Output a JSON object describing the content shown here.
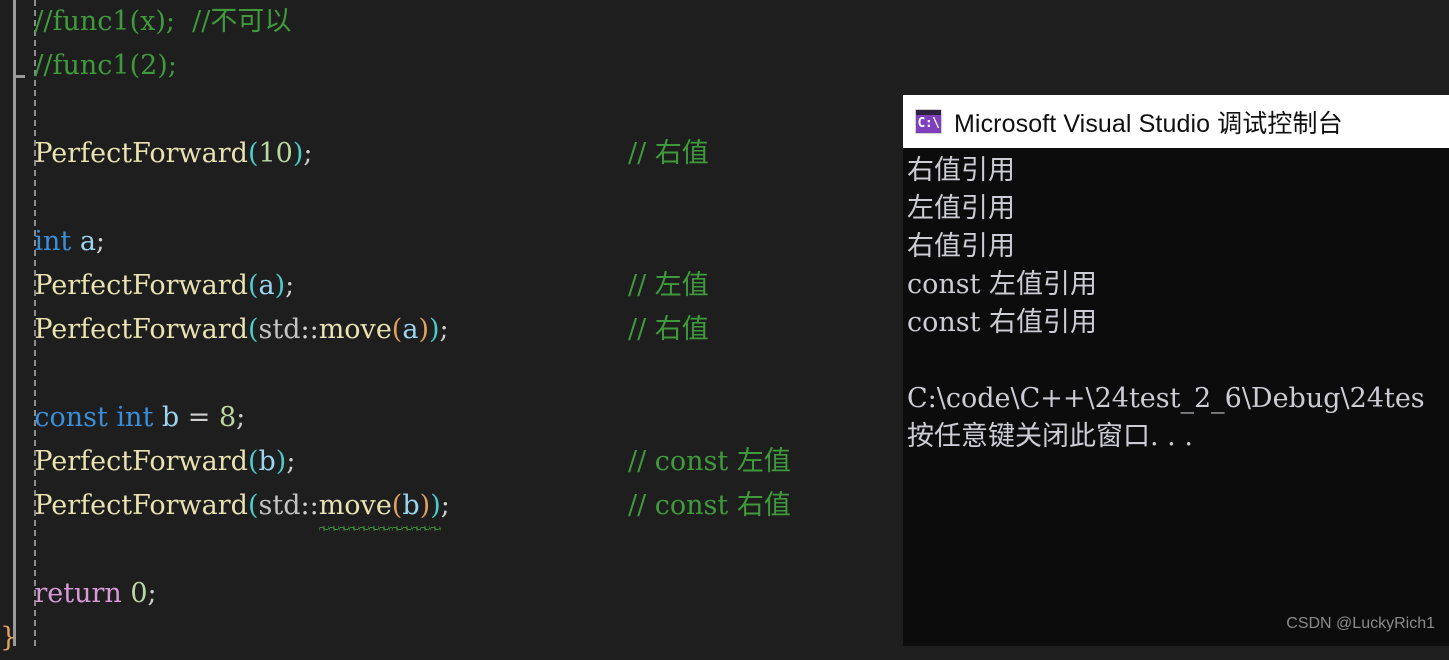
{
  "editor": {
    "background": "#1e1e1e",
    "gutter_guide_color": "#9a9a9a",
    "indent_guide_color": "#8c8c8c",
    "closing_brace": "}",
    "lines": [
      {
        "id": "line-func1-x",
        "segments": [
          {
            "cls": "t-cmt",
            "text": "    //func1(x);  //不可以"
          }
        ],
        "comment": ""
      },
      {
        "id": "line-func1-2",
        "segments": [
          {
            "cls": "t-cmt",
            "text": "    //func1(2);"
          }
        ],
        "comment": ""
      },
      {
        "id": "line-blank-1",
        "segments": [],
        "comment": ""
      },
      {
        "id": "line-pf-10",
        "segments": [
          {
            "cls": "",
            "text": "    "
          },
          {
            "cls": "t-fn",
            "text": "PerfectForward"
          },
          {
            "cls": "t-p1",
            "text": "("
          },
          {
            "cls": "t-num",
            "text": "10"
          },
          {
            "cls": "t-p1",
            "text": ")"
          },
          {
            "cls": "t-pun",
            "text": ";"
          }
        ],
        "comment": "// 右值"
      },
      {
        "id": "line-blank-2",
        "segments": [],
        "comment": ""
      },
      {
        "id": "line-int-a",
        "segments": [
          {
            "cls": "",
            "text": "    "
          },
          {
            "cls": "t-kw",
            "text": "int"
          },
          {
            "cls": "",
            "text": " "
          },
          {
            "cls": "t-var",
            "text": "a"
          },
          {
            "cls": "t-pun",
            "text": ";"
          }
        ],
        "comment": ""
      },
      {
        "id": "line-pf-a",
        "segments": [
          {
            "cls": "",
            "text": "    "
          },
          {
            "cls": "t-fn",
            "text": "PerfectForward"
          },
          {
            "cls": "t-p1",
            "text": "("
          },
          {
            "cls": "t-var",
            "text": "a"
          },
          {
            "cls": "t-p1",
            "text": ")"
          },
          {
            "cls": "t-pun",
            "text": ";"
          }
        ],
        "comment": "// 左值"
      },
      {
        "id": "line-pf-move-a",
        "segments": [
          {
            "cls": "",
            "text": "    "
          },
          {
            "cls": "t-fn",
            "text": "PerfectForward"
          },
          {
            "cls": "t-p1",
            "text": "("
          },
          {
            "cls": "t-ns",
            "text": "std"
          },
          {
            "cls": "t-pun",
            "text": "::"
          },
          {
            "cls": "t-fn",
            "text": "move"
          },
          {
            "cls": "t-p2",
            "text": "("
          },
          {
            "cls": "t-var",
            "text": "a"
          },
          {
            "cls": "t-p2",
            "text": ")"
          },
          {
            "cls": "t-p1",
            "text": ")"
          },
          {
            "cls": "t-pun",
            "text": ";"
          }
        ],
        "comment": "// 右值"
      },
      {
        "id": "line-blank-3",
        "segments": [],
        "comment": ""
      },
      {
        "id": "line-const-int-b",
        "segments": [
          {
            "cls": "",
            "text": "    "
          },
          {
            "cls": "t-kw",
            "text": "const"
          },
          {
            "cls": "",
            "text": " "
          },
          {
            "cls": "t-kw",
            "text": "int"
          },
          {
            "cls": "",
            "text": " "
          },
          {
            "cls": "t-var",
            "text": "b"
          },
          {
            "cls": "t-pun",
            "text": " = "
          },
          {
            "cls": "t-num",
            "text": "8"
          },
          {
            "cls": "t-pun",
            "text": ";"
          }
        ],
        "comment": ""
      },
      {
        "id": "line-pf-b",
        "segments": [
          {
            "cls": "",
            "text": "    "
          },
          {
            "cls": "t-fn",
            "text": "PerfectForward"
          },
          {
            "cls": "t-p1",
            "text": "("
          },
          {
            "cls": "t-var",
            "text": "b"
          },
          {
            "cls": "t-p1",
            "text": ")"
          },
          {
            "cls": "t-pun",
            "text": ";"
          }
        ],
        "comment": "// const 左值"
      },
      {
        "id": "line-pf-move-b",
        "segments": [
          {
            "cls": "",
            "text": "    "
          },
          {
            "cls": "t-fn",
            "text": "PerfectForward"
          },
          {
            "cls": "t-p1",
            "text": "("
          },
          {
            "cls": "t-ns",
            "text": "std"
          },
          {
            "cls": "t-pun",
            "text": "::"
          },
          {
            "cls": "t-fn squiggle",
            "text": "move"
          },
          {
            "cls": "t-p2 squiggle",
            "text": "("
          },
          {
            "cls": "t-var squiggle",
            "text": "b"
          },
          {
            "cls": "t-p2 squiggle",
            "text": ")"
          },
          {
            "cls": "t-p1 squiggle",
            "text": ")"
          },
          {
            "cls": "t-pun",
            "text": ";"
          }
        ],
        "comment": "// const 右值"
      },
      {
        "id": "line-blank-4",
        "segments": [],
        "comment": ""
      },
      {
        "id": "line-return",
        "segments": [
          {
            "cls": "",
            "text": "    "
          },
          {
            "cls": "t-ret",
            "text": "return"
          },
          {
            "cls": "",
            "text": " "
          },
          {
            "cls": "t-num",
            "text": "0"
          },
          {
            "cls": "t-pun",
            "text": ";"
          }
        ],
        "comment": ""
      },
      {
        "id": "line-close-brace",
        "segments": [
          {
            "cls": "t-brace",
            "text": "}"
          }
        ],
        "comment": ""
      }
    ]
  },
  "console": {
    "title": "Microsoft Visual Studio 调试控制台",
    "icon_glyph": "C:\\",
    "titlebar_background": "#ffffff",
    "body_background": "#0c0c0c",
    "output_lines": [
      "右值引用",
      "左值引用",
      "右值引用",
      "const 左值引用",
      "const 右值引用",
      "",
      "C:\\code\\C++\\24test_2_6\\Debug\\24tes",
      "按任意键关闭此窗口. . ."
    ]
  },
  "watermark": {
    "text": "CSDN @LuckyRich1"
  }
}
